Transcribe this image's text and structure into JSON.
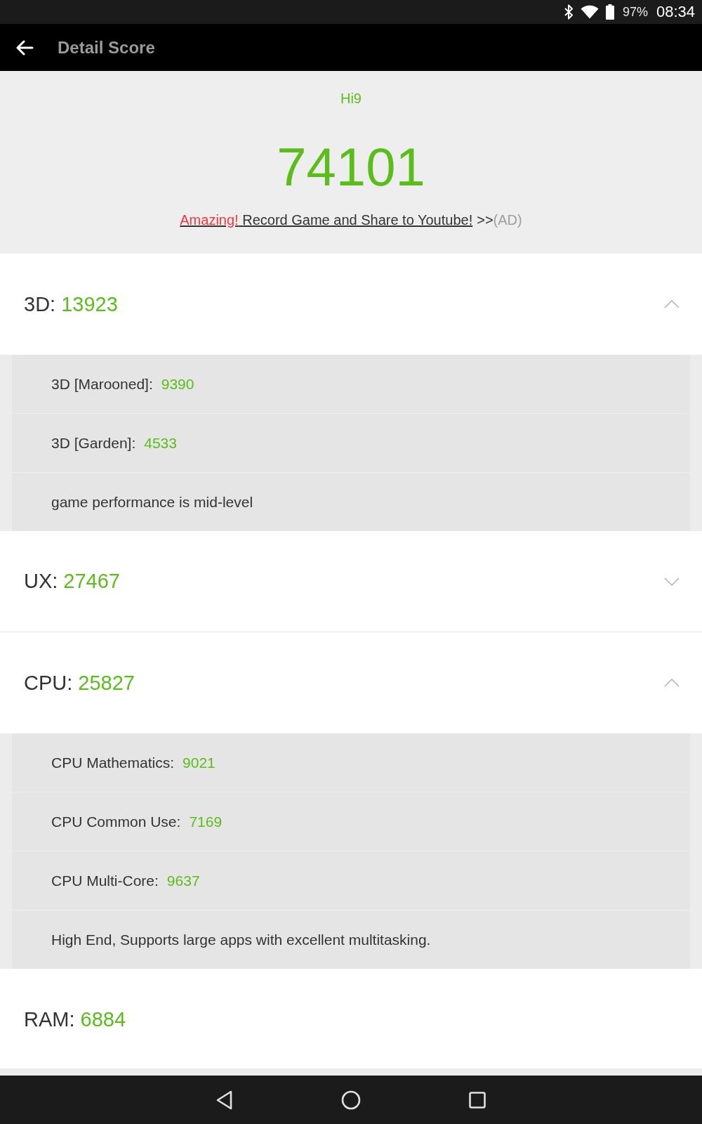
{
  "status_bar": {
    "battery": "97%",
    "time": "08:34"
  },
  "toolbar": {
    "title": "Detail Score"
  },
  "summary": {
    "device": "Hi9",
    "score": "74101",
    "ad": {
      "highlight": "Amazing!",
      "link": "Record Game and Share to Youtube!",
      "arrow": ">>",
      "tag": "(AD)"
    }
  },
  "sections": [
    {
      "kind": "collapsible",
      "label": "3D:",
      "score": "13923",
      "expanded": true,
      "items": [
        {
          "kind": "score",
          "label": "3D [Marooned]:",
          "score": "9390"
        },
        {
          "kind": "score",
          "label": "3D [Garden]:",
          "score": "4533"
        },
        {
          "kind": "note",
          "text": "game performance is mid-level"
        }
      ]
    },
    {
      "kind": "collapsible",
      "label": "UX:",
      "score": "27467",
      "expanded": false
    },
    {
      "kind": "collapsible",
      "label": "CPU:",
      "score": "25827",
      "expanded": true,
      "items": [
        {
          "kind": "score",
          "label": "CPU Mathematics:",
          "score": "9021"
        },
        {
          "kind": "score",
          "label": "CPU Common Use:",
          "score": "7169"
        },
        {
          "kind": "score",
          "label": "CPU Multi-Core:",
          "score": "9637"
        },
        {
          "kind": "note",
          "text": "High End, Supports large apps with excellent multitasking."
        }
      ]
    },
    {
      "kind": "plain",
      "label": "RAM:",
      "score": "6884"
    }
  ]
}
